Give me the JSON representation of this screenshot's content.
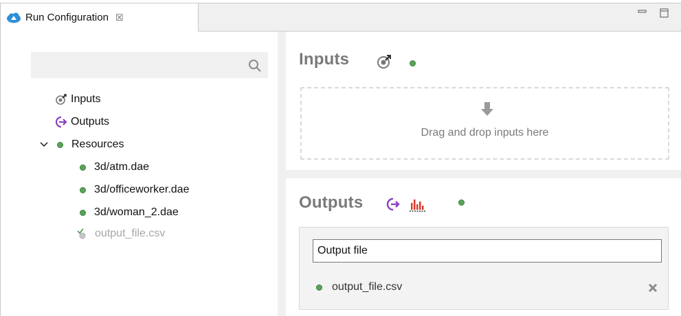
{
  "tab": {
    "title": "Run Configuration",
    "close_glyph": "☒"
  },
  "search": {
    "placeholder": "",
    "value": ""
  },
  "tree": {
    "items": [
      {
        "label": "Inputs",
        "icon": "inputs-icon"
      },
      {
        "label": "Outputs",
        "icon": "outputs-icon"
      },
      {
        "label": "Resources",
        "expanded": true,
        "status": "ok"
      },
      {
        "label": "3d/atm.dae",
        "status": "ok"
      },
      {
        "label": "3d/officeworker.dae",
        "status": "ok"
      },
      {
        "label": "3d/woman_2.dae",
        "status": "ok"
      },
      {
        "label": "output_file.csv",
        "status": "generated"
      }
    ]
  },
  "inputs_section": {
    "title": "Inputs",
    "drop_text": "Drag and drop inputs here"
  },
  "outputs_section": {
    "title": "Outputs",
    "field_value": "Output file",
    "file": {
      "name": "output_file.csv",
      "status": "ok"
    }
  },
  "colors": {
    "status_green": "#5aa35a",
    "outputs_purple": "#8a3fc7",
    "title_gray": "#7a7a7a"
  }
}
